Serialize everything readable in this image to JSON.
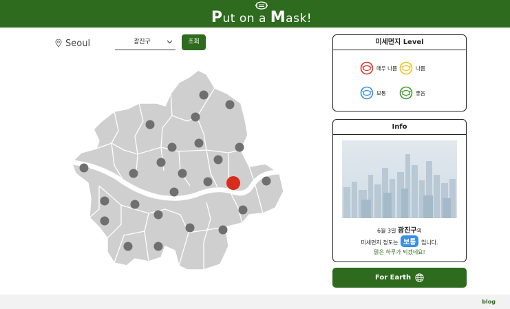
{
  "header": {
    "title_parts": [
      "P",
      "ut on a ",
      "M",
      "ask!"
    ],
    "icon": "mask-icon"
  },
  "controls": {
    "city": "Seoul",
    "city_icon": "location-pin-icon",
    "district_selected": "광진구",
    "search_label": "조회"
  },
  "map": {
    "selected_district": "광진구",
    "district_count": 25,
    "colors": {
      "district": "#cfcfcf",
      "marker": "#6f6f6f",
      "selected_marker": "#d82c1e",
      "border": "#ffffff"
    }
  },
  "level_card": {
    "title": "미세먼지 Level",
    "items": [
      {
        "label": "매우 나쁨",
        "color": "#d8342a",
        "icon": "mask-icon"
      },
      {
        "label": "나쁨",
        "color": "#e9c21b",
        "icon": "mask-icon"
      },
      {
        "label": "보통",
        "color": "#3b8ee8",
        "icon": "mask-icon"
      },
      {
        "label": "좋음",
        "color": "#3f9b2c",
        "icon": "mask-icon"
      }
    ]
  },
  "info_card": {
    "title": "Info",
    "date": "6월 3일",
    "district": "광진구",
    "suffix_1": "의",
    "prefix_2": "미세먼지 정도는",
    "level": "보통",
    "suffix_2": "입니다.",
    "message": "맑은 하루가 되겠네요!"
  },
  "earth_button": {
    "label": "For Earth",
    "icon": "globe-icon"
  },
  "footer": {
    "blog_label": "blog"
  }
}
